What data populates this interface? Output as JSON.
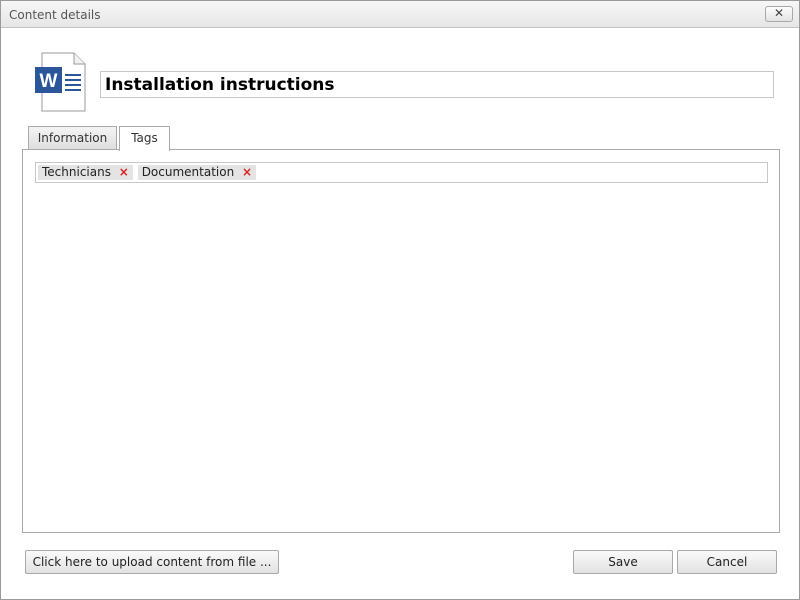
{
  "window": {
    "title": "Content details",
    "close_label": "✕"
  },
  "document": {
    "icon_letter": "W",
    "title_value": "Installation instructions",
    "colors": {
      "word_blue": "#2b579a"
    }
  },
  "tabs": [
    {
      "label": "Information",
      "active": false
    },
    {
      "label": "Tags",
      "active": true
    }
  ],
  "tags": [
    {
      "label": "Technicians",
      "remove": "×"
    },
    {
      "label": "Documentation",
      "remove": "×"
    }
  ],
  "footer": {
    "upload_label": "Click here to upload content from file ...",
    "save_label": "Save",
    "cancel_label": "Cancel"
  }
}
